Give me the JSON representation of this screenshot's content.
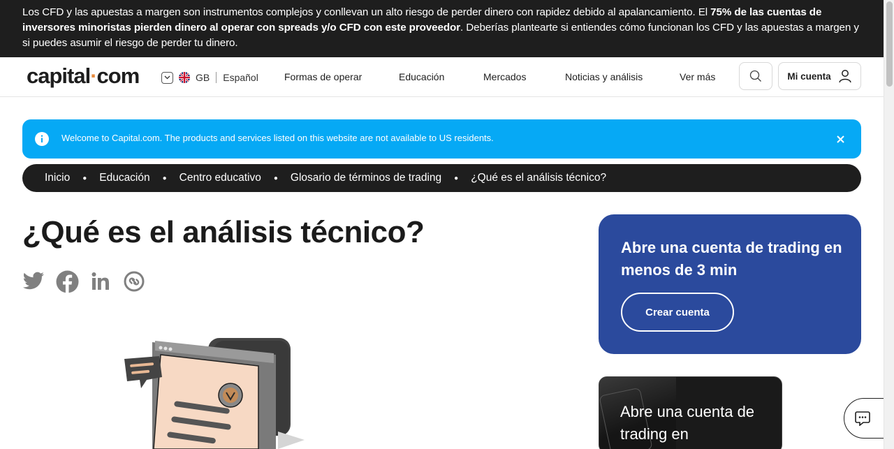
{
  "risk_banner": {
    "part1": "Los CFD y las apuestas a margen son instrumentos complejos y conllevan un alto riesgo de perder dinero con rapidez debido al apalancamiento. El ",
    "bold": "75% de las cuentas de inversores minoristas pierden dinero al operar con spreads y/o CFD con este proveedor",
    "part2": ". Deberías plantearte si entiendes cómo funcionan los CFD y las apuestas a margen y si puedes asumir el riesgo de perder tu dinero."
  },
  "header": {
    "logo_left": "capital",
    "logo_dot": "·",
    "logo_right": "com",
    "region": "GB",
    "language": "Español",
    "nav": [
      "Formas de operar",
      "Educación",
      "Mercados",
      "Noticias y análisis",
      "Ver más"
    ],
    "account_label": "Mi cuenta"
  },
  "info_banner": {
    "text": "Welcome to Capital.com. The products and services listed on this website are not available to US residents."
  },
  "breadcrumb": [
    "Inicio",
    "Educación",
    "Centro educativo",
    "Glosario de términos de trading",
    "¿Qué es el análisis técnico?"
  ],
  "page": {
    "title": "¿Qué es el análisis técnico?"
  },
  "share_icons": [
    "twitter-icon",
    "facebook-icon",
    "linkedin-icon",
    "copy-link-icon"
  ],
  "cta": {
    "title": "Abre una cuenta de trading en menos de 3 min",
    "button": "Crear cuenta"
  },
  "promo": {
    "text": "Abre una cuenta de trading en"
  },
  "colors": {
    "risk_banner_bg": "#1e1e1e",
    "info_banner_bg": "#06a9f5",
    "cta_bg": "#2b4a9d",
    "logo_accent": "#e88a3c"
  }
}
